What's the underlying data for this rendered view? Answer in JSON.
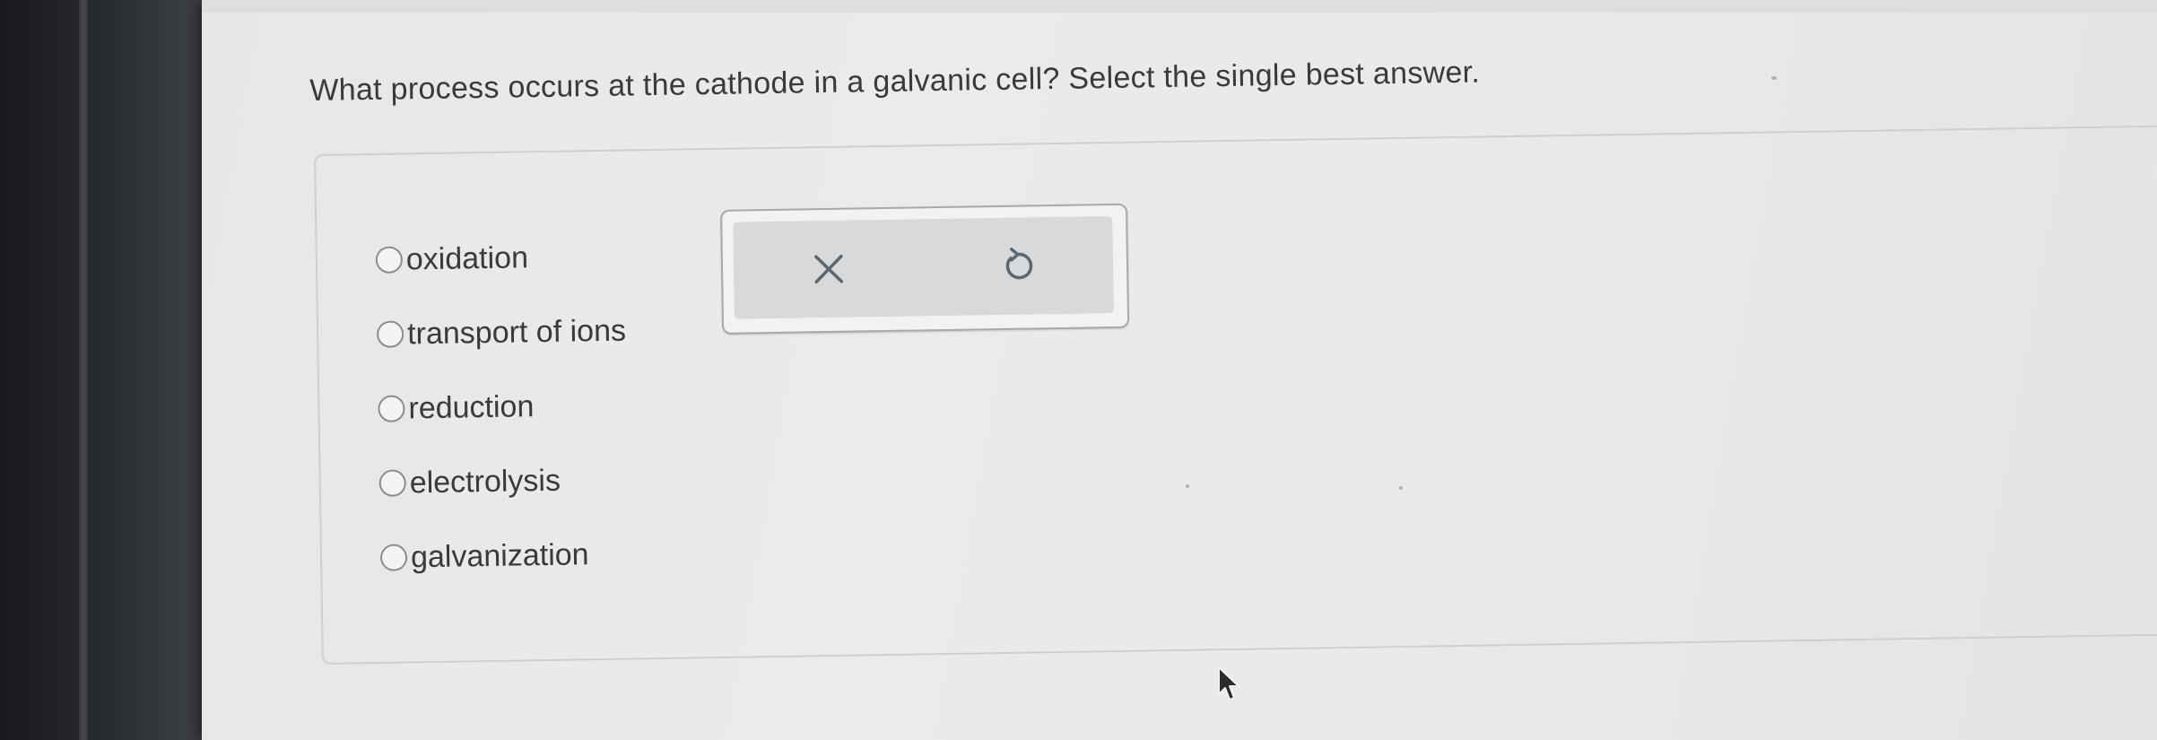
{
  "question": {
    "text": "What process occurs at the cathode in a galvanic cell? Select the single best answer."
  },
  "options": [
    {
      "label": "oxidation",
      "selected": false
    },
    {
      "label": "transport of ions",
      "selected": false
    },
    {
      "label": "reduction",
      "selected": false
    },
    {
      "label": "electrolysis",
      "selected": false
    },
    {
      "label": "galvanization",
      "selected": false
    }
  ],
  "toolbar": {
    "clear_icon": "x-icon",
    "undo_icon": "undo-icon"
  },
  "colors": {
    "screen_bg": "#e9e9e7",
    "text": "#3a3a3a",
    "tool_bg": "#d7d9da",
    "icon": "#5b6770"
  }
}
